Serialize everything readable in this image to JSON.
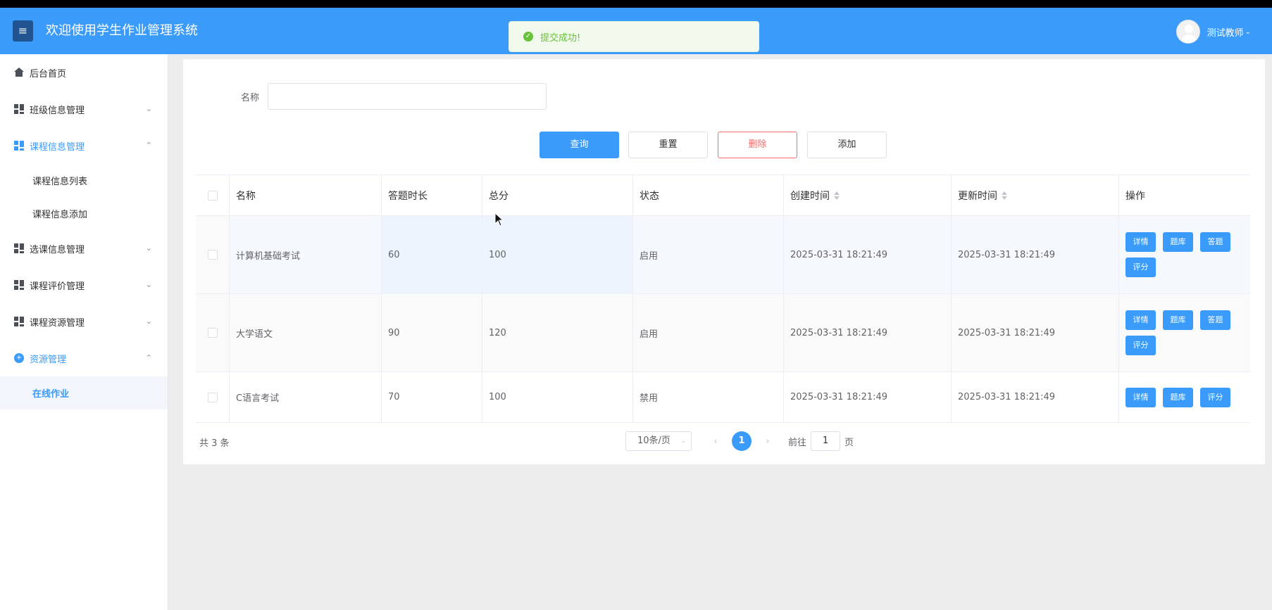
{
  "header": {
    "menu_icon": "≡",
    "title": "欢迎使用学生作业管理系统",
    "user_name": "测试教师",
    "user_caret": "⌄"
  },
  "toast": {
    "icon": "✓",
    "message": "提交成功!"
  },
  "sidebar": {
    "items": [
      {
        "label": "后台首页",
        "icon": "home-icon"
      },
      {
        "label": "班级信息管理",
        "icon": "grid-icon",
        "arrow": "⌄"
      },
      {
        "label": "课程信息管理",
        "icon": "grid-icon",
        "arrow": "⌃",
        "active": true
      },
      {
        "label": "课程信息列表"
      },
      {
        "label": "课程信息添加"
      },
      {
        "label": "选课信息管理",
        "icon": "grid-icon",
        "arrow": "⌄"
      },
      {
        "label": "课程评价管理",
        "icon": "grid-icon",
        "arrow": "⌄"
      },
      {
        "label": "课程资源管理",
        "icon": "grid-icon",
        "arrow": "⌄"
      },
      {
        "label": "资源管理",
        "icon": "plus-circle-icon",
        "arrow": "⌃",
        "active": true
      },
      {
        "label": "在线作业",
        "selected": true
      }
    ]
  },
  "search": {
    "label": "名称",
    "value": "",
    "placeholder": ""
  },
  "toolbar": {
    "query": "查询",
    "reset": "重置",
    "delete": "删除",
    "add": "添加"
  },
  "table": {
    "columns": [
      "名称",
      "答题时长",
      "总分",
      "状态",
      "创建时间",
      "更新时间",
      "操作"
    ],
    "rows": [
      {
        "name": "计算机基础考试",
        "duration": "60",
        "score": "100",
        "status": "启用",
        "created": "2025-03-31 18:21:49",
        "updated": "2025-03-31 18:21:49",
        "actions": [
          "详情",
          "题库",
          "答题",
          "评分"
        ]
      },
      {
        "name": "大学语文",
        "duration": "90",
        "score": "120",
        "status": "启用",
        "created": "2025-03-31 18:21:49",
        "updated": "2025-03-31 18:21:49",
        "actions": [
          "详情",
          "题库",
          "答题",
          "评分"
        ]
      },
      {
        "name": "C语言考试",
        "duration": "70",
        "score": "100",
        "status": "禁用",
        "created": "2025-03-31 18:21:49",
        "updated": "2025-03-31 18:21:49",
        "actions": [
          "详情",
          "题库",
          "评分"
        ]
      }
    ]
  },
  "pagination": {
    "total": "共 3 条",
    "page_size": "10条/页",
    "page_size_caret": "⌄",
    "prev": "‹",
    "current": "1",
    "next": "›",
    "goto_prefix": "前往",
    "goto_value": "1",
    "goto_suffix": "页"
  },
  "colors": {
    "primary": "#3a9bfa",
    "danger": "#f56c6c",
    "success": "#67c23a",
    "header_button": "#20538f"
  }
}
